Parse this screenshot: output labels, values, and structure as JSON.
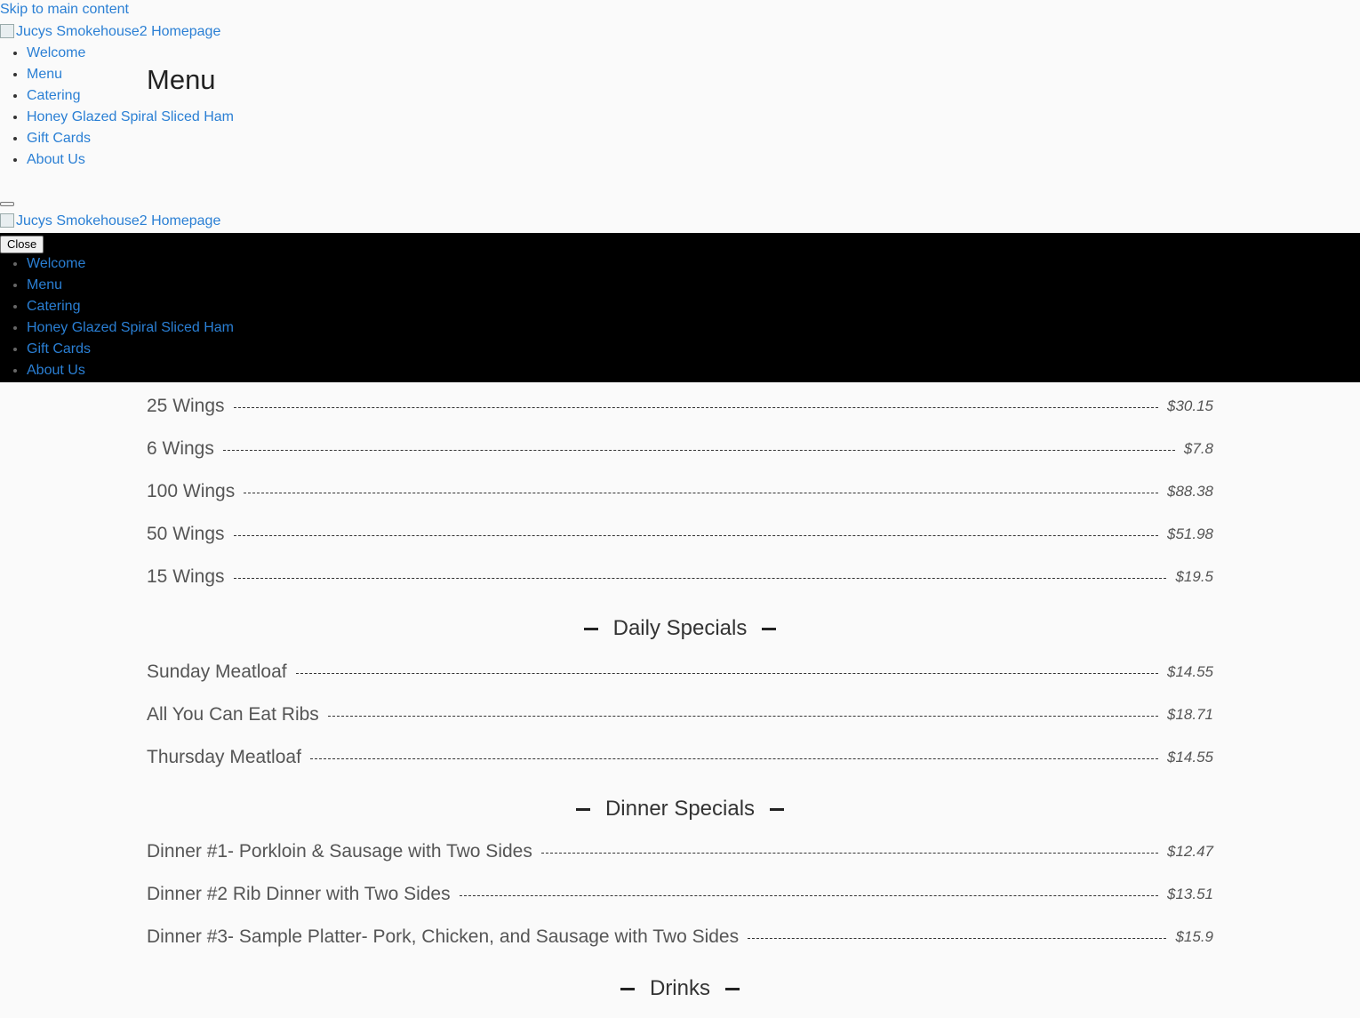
{
  "skip_link": "Skip to main content",
  "logo_alt": "Jucys Smokehouse2 Homepage",
  "nav_items": [
    "Welcome",
    "Menu",
    "Catering",
    "Honey Glazed Spiral Sliced Ham",
    "Gift Cards",
    "About Us"
  ],
  "close_label": "Close",
  "page_title": "Menu",
  "sections": [
    {
      "title": "",
      "items": [
        {
          "name": "25 Wings",
          "price": "$30.15"
        },
        {
          "name": "6 Wings",
          "price": "$7.8"
        },
        {
          "name": "100 Wings",
          "price": "$88.38"
        },
        {
          "name": "50 Wings",
          "price": "$51.98"
        },
        {
          "name": "15 Wings",
          "price": "$19.5"
        }
      ]
    },
    {
      "title": "Daily Specials",
      "items": [
        {
          "name": "Sunday Meatloaf",
          "price": "$14.55"
        },
        {
          "name": "All You Can Eat Ribs",
          "price": "$18.71"
        },
        {
          "name": "Thursday Meatloaf",
          "price": "$14.55"
        }
      ]
    },
    {
      "title": "Dinner Specials",
      "items": [
        {
          "name": "Dinner #1- Porkloin & Sausage with Two Sides",
          "price": "$12.47"
        },
        {
          "name": "Dinner #2 Rib Dinner with Two Sides",
          "price": "$13.51"
        },
        {
          "name": "Dinner #3- Sample Platter- Pork, Chicken, and Sausage with Two Sides",
          "price": "$15.9"
        }
      ]
    },
    {
      "title": "Drinks",
      "items": []
    }
  ]
}
